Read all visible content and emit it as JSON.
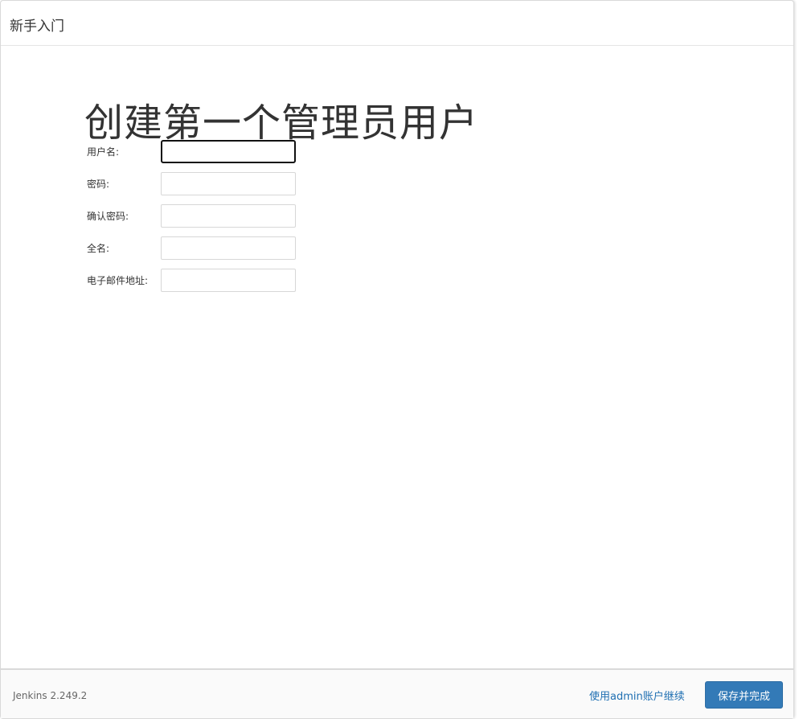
{
  "dialog": {
    "title": "新手入门"
  },
  "main": {
    "heading": "创建第一个管理员用户",
    "fields": [
      {
        "label": "用户名:",
        "value": ""
      },
      {
        "label": "密码:",
        "value": ""
      },
      {
        "label": "确认密码:",
        "value": ""
      },
      {
        "label": "全名:",
        "value": ""
      },
      {
        "label": "电子邮件地址:",
        "value": ""
      }
    ]
  },
  "footer": {
    "version": "Jenkins 2.249.2",
    "skip_label": "使用admin账户继续",
    "save_label": "保存并完成"
  },
  "colors": {
    "primary_button": "#337ab7",
    "link": "#1f6fb2"
  }
}
